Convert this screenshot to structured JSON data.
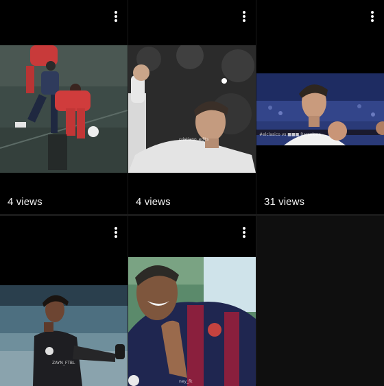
{
  "videos": [
    {
      "views": "4 views",
      "menu_icon": "more-vert-icon"
    },
    {
      "views": "4 views",
      "menu_icon": "more-vert-icon",
      "watermark": "cristiano_edits"
    },
    {
      "views": "31 views",
      "menu_icon": "more-vert-icon",
      "watermark": "#elclasico vs ■■■ Barcelona"
    },
    {
      "views": "",
      "menu_icon": "more-vert-icon",
      "watermark": "ZAYN_FTBL"
    },
    {
      "views": "",
      "menu_icon": "more-vert-icon",
      "watermark": "ney_fk"
    }
  ],
  "colors": {
    "background": "#0f0f0f",
    "text": "#f1f1f1"
  }
}
